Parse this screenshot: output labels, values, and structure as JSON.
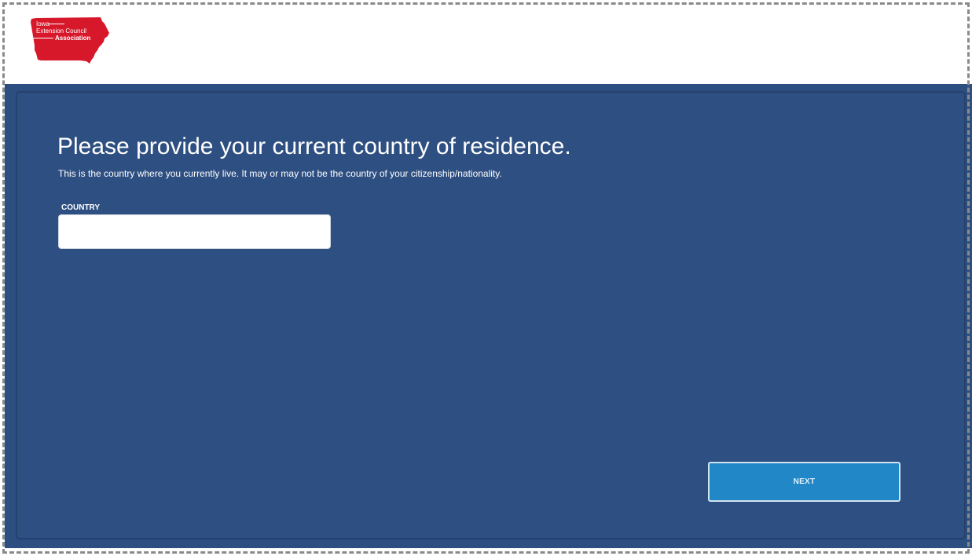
{
  "header": {
    "logo": {
      "lines": [
        "Iowa",
        "Extension Council",
        "Association"
      ],
      "color": "#d7172a",
      "icon": "iowa-state-shape-icon"
    }
  },
  "form": {
    "title": "Please provide your current country of residence.",
    "subtitle": "This is the country where you currently live. It may or may not be the country of your citizenship/nationality.",
    "country_label": "COUNTRY",
    "country_value": "",
    "next_label": "NEXT"
  },
  "colors": {
    "panel_background": "#2e4f81",
    "button_background": "#2187c6",
    "text": "#ffffff"
  }
}
